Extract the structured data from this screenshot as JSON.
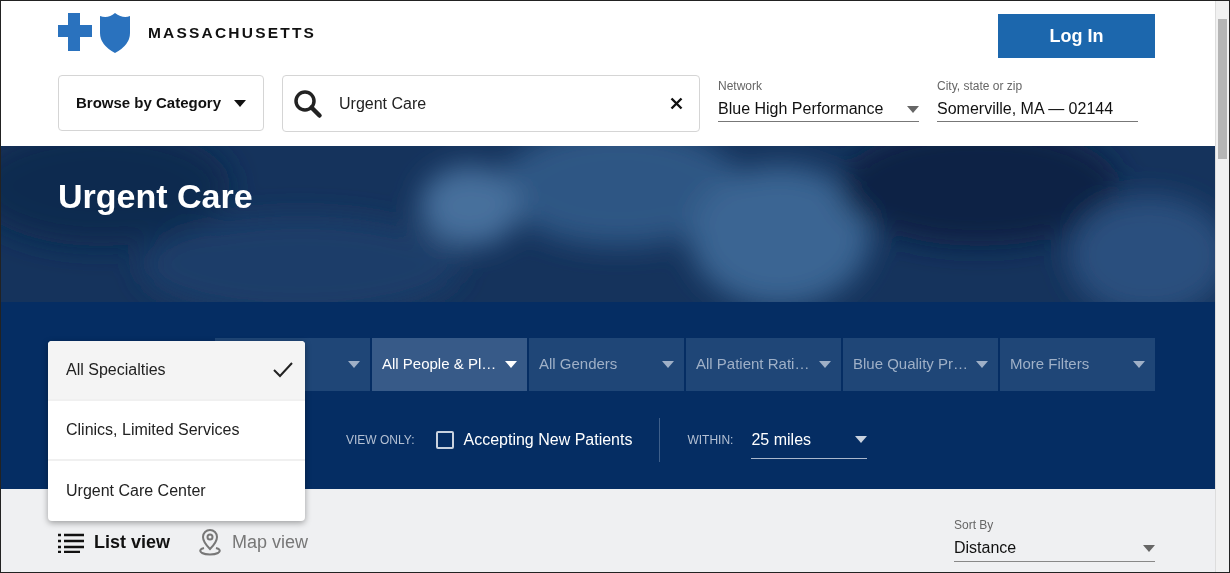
{
  "header": {
    "logo_text": "MASSACHUSETTS",
    "login_button": "Log In"
  },
  "search_bar": {
    "category_button": "Browse by Category",
    "query": "Urgent Care",
    "network": {
      "label": "Network",
      "value": "Blue High Performance"
    },
    "location": {
      "label": "City, state or zip",
      "value": "Somerville, MA — 02144"
    }
  },
  "hero": {
    "title": "Urgent Care"
  },
  "filters": [
    {
      "active": false
    },
    {
      "label": "All People & Pl…",
      "active": true
    },
    {
      "label": "All Genders",
      "active": false
    },
    {
      "label": "All Patient Rati…",
      "active": false
    },
    {
      "label": "Blue Quality Pr…",
      "active": false
    },
    {
      "label": "More Filters",
      "active": false
    }
  ],
  "specialty_menu": {
    "options": [
      {
        "label": "All Specialties",
        "selected": true
      },
      {
        "label": "Clinics, Limited Services",
        "selected": false
      },
      {
        "label": "Urgent Care Center",
        "selected": false
      }
    ]
  },
  "view_only": {
    "label": "VIEW ONLY:",
    "option": {
      "label": "Accepting New Patients",
      "checked": false
    }
  },
  "within": {
    "label": "WITHIN:",
    "value": "25 miles"
  },
  "view_toggle": [
    {
      "label": "List view",
      "kind": "list",
      "selected": true
    },
    {
      "label": "Map view",
      "kind": "map",
      "selected": false
    }
  ],
  "sort": {
    "label": "Sort By",
    "value": "Distance"
  }
}
